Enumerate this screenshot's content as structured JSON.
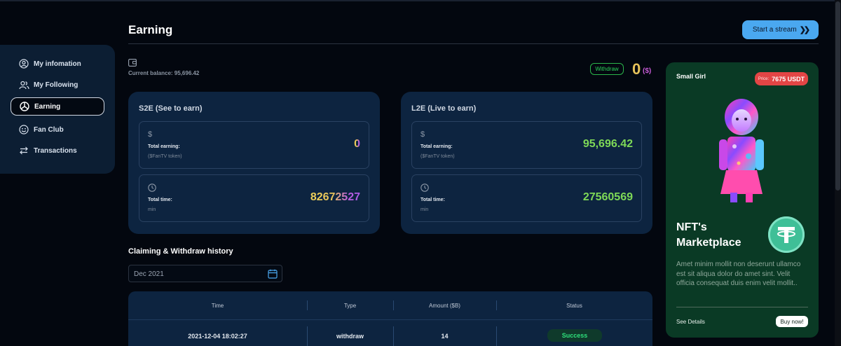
{
  "header": {
    "title": "Earning",
    "stream_button": "Start a stream"
  },
  "sidebar": {
    "items": [
      {
        "label": "My infomation",
        "icon": "user-circle-icon",
        "active": false
      },
      {
        "label": "My Following",
        "icon": "users-icon",
        "active": false
      },
      {
        "label": "Earning",
        "icon": "chart-pie-icon",
        "active": true
      },
      {
        "label": "Fan Club",
        "icon": "smiley-icon",
        "active": false
      },
      {
        "label": "Transactions",
        "icon": "arrows-exchange-icon",
        "active": false
      }
    ]
  },
  "balance": {
    "label": "Current balance: 95,696.42",
    "withdraw_button": "Withdraw",
    "amount": "0",
    "unit": "($)"
  },
  "s2e": {
    "title": "S2E (See to earn)",
    "earning_label": "Total earning:",
    "earning_sub": "($FanTV token)",
    "earning_value": "0",
    "time_label": "Total time:",
    "time_sub": "min",
    "time_value": "82672527"
  },
  "l2e": {
    "title": "L2E (Live to earn)",
    "earning_label": "Total earning:",
    "earning_sub": "($FanTV token)",
    "earning_value": "95,696.42",
    "time_label": "Total time:",
    "time_sub": "min",
    "time_value": "27560569"
  },
  "history": {
    "title": "Claiming & Withdraw history",
    "date_value": "Dec 2021",
    "columns": [
      "Time",
      "Type",
      "Amount ($B)",
      "Status"
    ],
    "rows": [
      {
        "time": "2021-12-04 18:02:27",
        "type": "withdraw",
        "amount": "14",
        "status": "Success"
      }
    ]
  },
  "nft": {
    "name": "Small Girl",
    "price_label": "Price:",
    "price_value": "7675 USDT",
    "heading": "NFT's Marketplace",
    "description": "Amet minim mollit non deserunt ullamco est sit aliqua dolor do amet sint. Velit officia consequat duis enim velit mollit..",
    "see_details": "See Details",
    "buy_button": "Buy now!"
  },
  "colors": {
    "accent_blue": "#4aa8f0",
    "success_green": "#2ee07a",
    "price_red": "#e34545",
    "nft_card_bg": "#0a3a25"
  }
}
